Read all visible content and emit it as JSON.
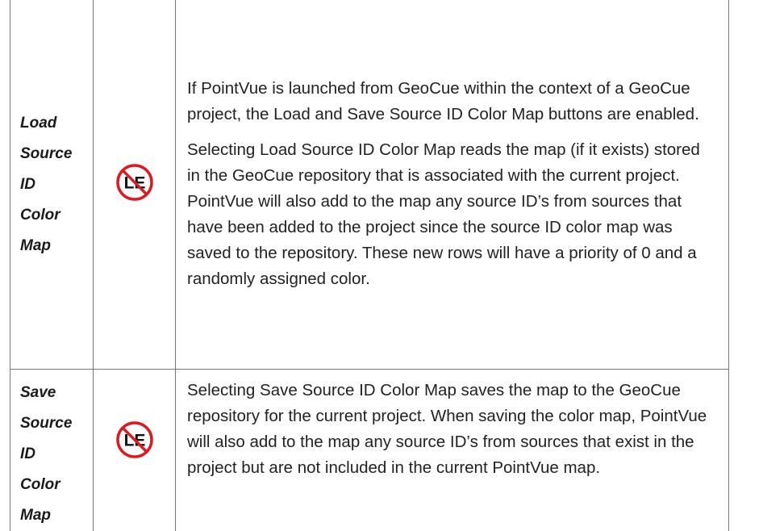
{
  "rows": [
    {
      "name_lines": [
        "Load",
        "Source",
        "ID",
        "Color",
        "Map"
      ],
      "icon": {
        "name": "no-le-icon",
        "label": "LE"
      },
      "paragraphs": [
        "If PointVue is launched from GeoCue within the context of a GeoCue project, the Load and Save Source ID Color Map buttons are enabled.",
        "Selecting Load Source ID Color Map reads the map (if it exists) stored in the GeoCue repository that is associated with the current project.  PointVue will also add to the map any source ID’s from sources that have been added to the project since the source ID color map was saved to the repository.  These new rows will have a priority of 0 and a randomly assigned color."
      ]
    },
    {
      "name_lines": [
        "Save",
        "Source",
        "ID",
        "Color",
        "Map"
      ],
      "icon": {
        "name": "no-le-icon",
        "label": "LE"
      },
      "paragraphs": [
        "Selecting Save Source ID Color Map saves the map to the GeoCue repository for the current project.  When saving the color map, PointVue will also add to the map any source ID’s from sources that exist in the project but are not included in the current PointVue map."
      ]
    }
  ],
  "colors": {
    "prohibit_red": "#e0191f",
    "border": "#777777",
    "text": "#222222"
  }
}
